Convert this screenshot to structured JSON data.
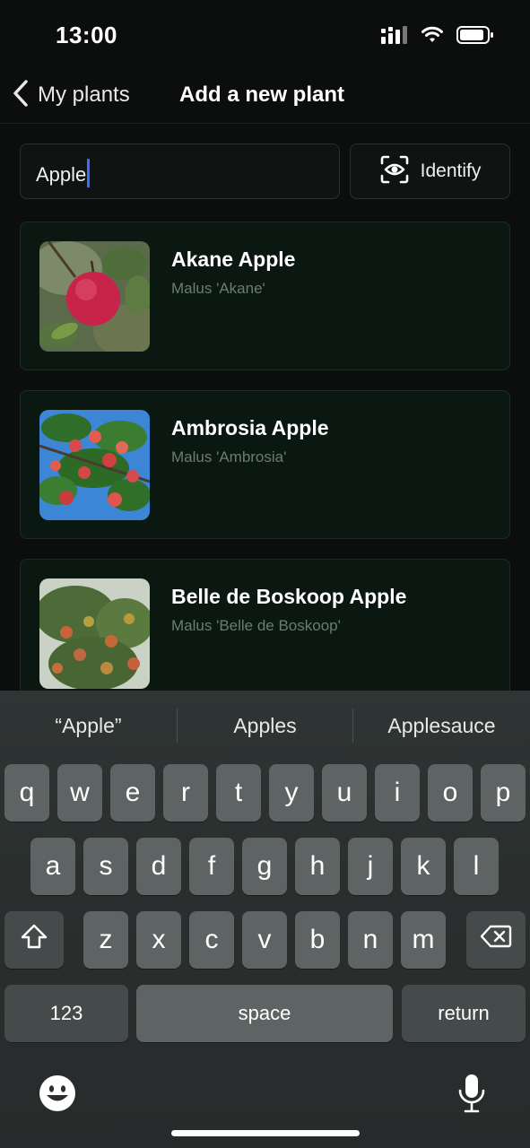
{
  "status": {
    "time": "13:00"
  },
  "nav": {
    "back_label": "My plants",
    "title": "Add a new plant"
  },
  "search": {
    "value": "Apple"
  },
  "identify": {
    "label": "Identify"
  },
  "results": [
    {
      "name": "Akane Apple",
      "scientific": "Malus 'Akane'"
    },
    {
      "name": "Ambrosia Apple",
      "scientific": "Malus 'Ambrosia'"
    },
    {
      "name": "Belle de Boskoop Apple",
      "scientific": "Malus 'Belle de Boskoop'"
    }
  ],
  "keyboard": {
    "suggestions": [
      "“Apple”",
      "Apples",
      "Applesauce"
    ],
    "row1": [
      "q",
      "w",
      "e",
      "r",
      "t",
      "y",
      "u",
      "i",
      "o",
      "p"
    ],
    "row2": [
      "a",
      "s",
      "d",
      "f",
      "g",
      "h",
      "j",
      "k",
      "l"
    ],
    "row3": [
      "z",
      "x",
      "c",
      "v",
      "b",
      "n",
      "m"
    ],
    "numbers_label": "123",
    "space_label": "space",
    "return_label": "return"
  }
}
